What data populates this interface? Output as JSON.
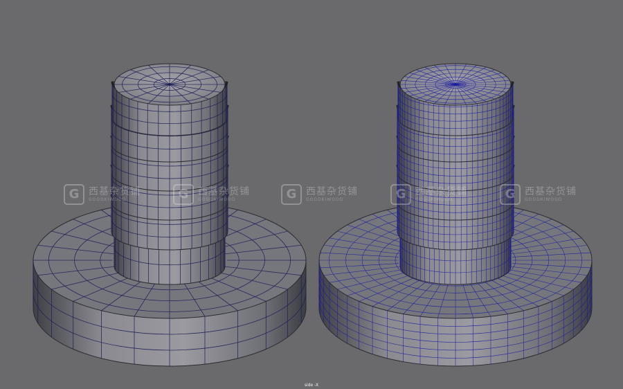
{
  "viewport": {
    "camera_label": "side -X",
    "background_color": "#6a6a6d"
  },
  "watermark": {
    "badge": "G",
    "text_cn": "西基杂货铺",
    "text_en": "GOODKIWOOD",
    "color": "#e8e8e8"
  },
  "models": [
    {
      "name": "low-poly-bolt",
      "wire_color": "#1f1f57",
      "shade_color": "#8e8e95"
    },
    {
      "name": "high-poly-bolt",
      "wire_color": "#1b1ba0",
      "shade_color": "#8e8e95"
    }
  ]
}
